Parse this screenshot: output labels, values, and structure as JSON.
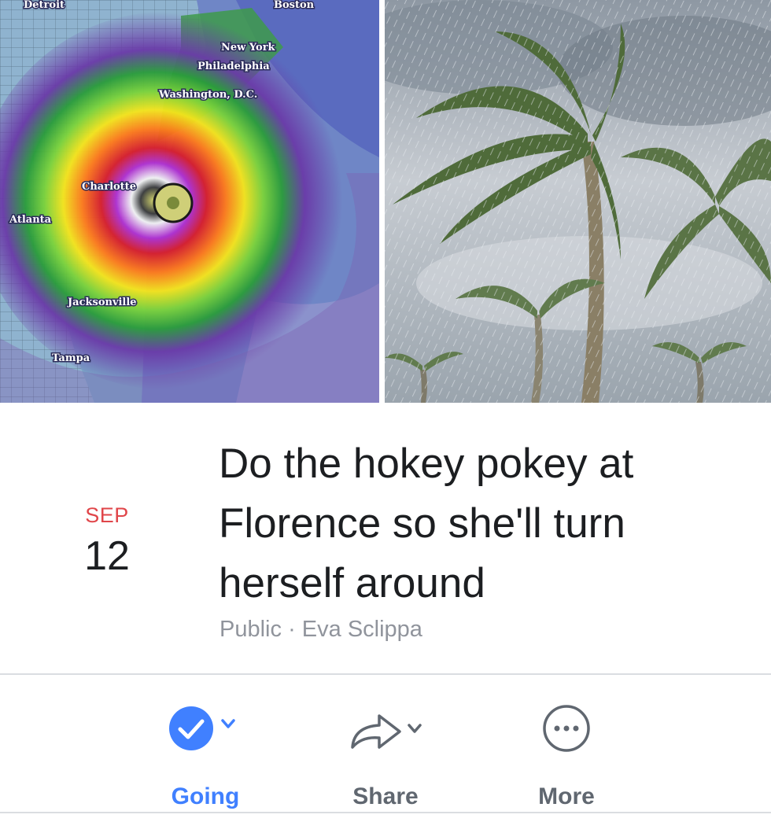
{
  "cover": {
    "map_cities": [
      "Detroit",
      "Boston",
      "New York",
      "Philadelphia",
      "Washington, D.C.",
      "Charlotte",
      "Atlanta",
      "Jacksonville",
      "Tampa"
    ]
  },
  "event": {
    "month": "SEP",
    "day": "12",
    "title": "Do the hokey pokey at Florence so she'll turn herself around",
    "privacy": "Public",
    "separator": "·",
    "host": "Eva Sclippa"
  },
  "actions": {
    "going": {
      "label": "Going",
      "icon": "check-circle-icon",
      "color": "#4080ff"
    },
    "share": {
      "label": "Share",
      "icon": "share-arrow-icon"
    },
    "more": {
      "label": "More",
      "icon": "more-dots-icon"
    }
  },
  "colors": {
    "accent": "#4080ff",
    "date_red": "#e0464a",
    "text": "#1c1e21",
    "muted": "#90949c"
  }
}
